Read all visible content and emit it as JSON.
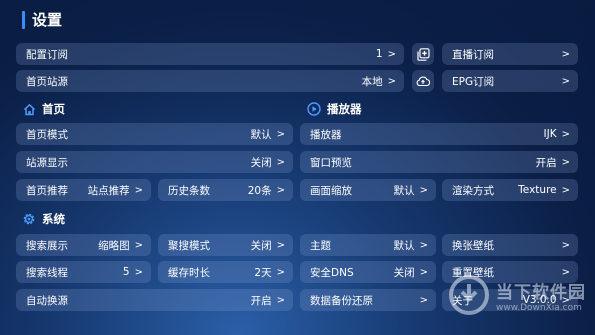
{
  "page": {
    "title": "设置"
  },
  "top": {
    "config_sub": {
      "label": "配置订阅",
      "value": "1"
    },
    "home_source": {
      "label": "首页站源",
      "value": "本地"
    },
    "live_sub": {
      "label": "直播订阅"
    },
    "epg_sub": {
      "label": "EPG订阅"
    },
    "add_icon": "plus-square-icon",
    "cloud_icon": "cloud-upload-icon"
  },
  "home": {
    "title": "首页",
    "icon": "home-icon",
    "mode": {
      "label": "首页模式",
      "value": "默认"
    },
    "source_display": {
      "label": "站源显示",
      "value": "关闭"
    },
    "recommend": {
      "label": "首页推荐",
      "value": "站点推荐"
    },
    "history": {
      "label": "历史条数",
      "value": "20条"
    }
  },
  "player": {
    "title": "播放器",
    "icon": "play-circle-icon",
    "player": {
      "label": "播放器",
      "value": "IJK"
    },
    "window_preview": {
      "label": "窗口预览",
      "value": "开启"
    },
    "zoom": {
      "label": "画面缩放",
      "value": "默认"
    },
    "render": {
      "label": "渲染方式",
      "value": "Texture"
    }
  },
  "system": {
    "title": "系统",
    "icon": "gear-icon",
    "search_display": {
      "label": "搜索展示",
      "value": "缩略图"
    },
    "search_mode": {
      "label": "聚搜模式",
      "value": "关闭"
    },
    "theme": {
      "label": "主题",
      "value": "默认"
    },
    "wallpaper_change": {
      "label": "换张壁纸"
    },
    "search_threads": {
      "label": "搜索线程",
      "value": "5"
    },
    "cache_duration": {
      "label": "缓存时长",
      "value": "2天"
    },
    "secure_dns": {
      "label": "安全DNS",
      "value": "关闭"
    },
    "wallpaper_reset": {
      "label": "重置壁纸"
    },
    "auto_switch": {
      "label": "自动换源",
      "value": "开启"
    },
    "backup_restore": {
      "label": "数据备份还原"
    },
    "about": {
      "label": "关于",
      "value": "V3.0.0"
    }
  },
  "arrow": ">",
  "watermark": {
    "main": "当下软件园",
    "sub": "www.DownXia.com"
  },
  "colors": {
    "accent": "#3b8cff",
    "card": "rgba(140,170,220,0.22)"
  }
}
